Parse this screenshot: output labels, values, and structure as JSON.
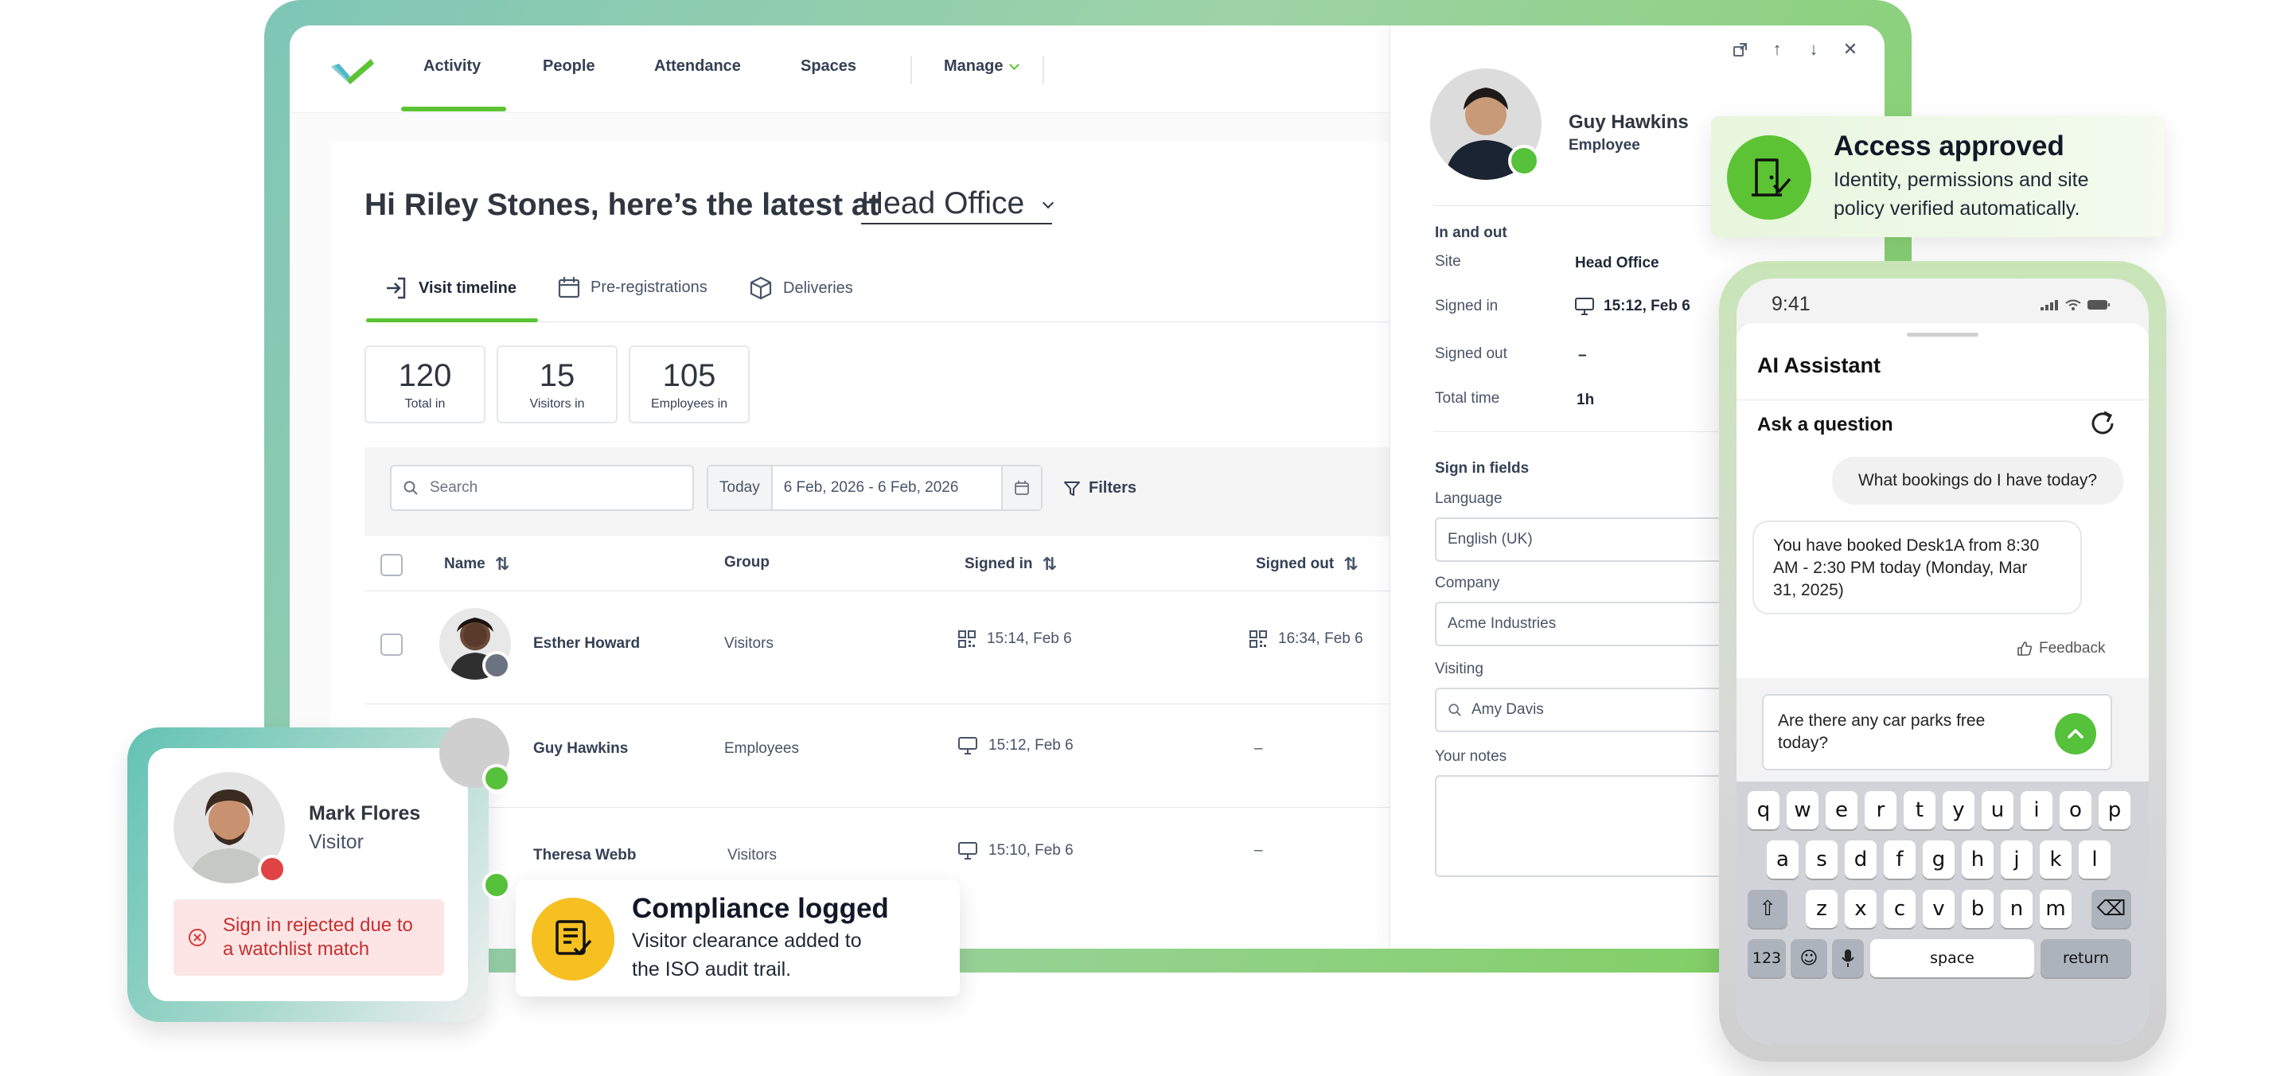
{
  "nav": {
    "items": [
      "Activity",
      "People",
      "Attendance",
      "Spaces",
      "Manage"
    ],
    "active": "Activity"
  },
  "header": {
    "greeting": "Hi Riley Stones, here’s the latest at",
    "site": "Head Office"
  },
  "tabs": [
    {
      "label": "Visit timeline",
      "icon": "sign-in-icon",
      "active": true
    },
    {
      "label": "Pre-registrations",
      "icon": "calendar-icon",
      "active": false
    },
    {
      "label": "Deliveries",
      "icon": "box-icon",
      "active": false
    }
  ],
  "stats": [
    {
      "value": "120",
      "label": "Total in"
    },
    {
      "value": "15",
      "label": "Visitors in"
    },
    {
      "value": "105",
      "label": "Employees in"
    }
  ],
  "filters": {
    "search_placeholder": "Search",
    "today_label": "Today",
    "date_range": "6 Feb, 2026 - 6 Feb, 2026",
    "filters_label": "Filters"
  },
  "table": {
    "headers": [
      "Name",
      "Group",
      "Signed in",
      "Signed out"
    ],
    "rows": [
      {
        "name": "Esther Howard",
        "group": "Visitors",
        "signed_in": "15:14, Feb 6",
        "signed_in_icon": "qr-code-icon",
        "signed_out": "16:34, Feb 6",
        "signed_out_icon": "qr-code-icon",
        "status": "grey"
      },
      {
        "name": "Guy Hawkins",
        "group": "Employees",
        "signed_in": "15:12, Feb 6",
        "signed_in_icon": "monitor-icon",
        "signed_out": "–",
        "status": "green"
      },
      {
        "name": "Theresa Webb",
        "group": "Visitors",
        "signed_in": "15:10, Feb 6",
        "signed_in_icon": "monitor-icon",
        "signed_out": "–",
        "status": "green"
      }
    ]
  },
  "panel": {
    "name": "Guy Hawkins",
    "role": "Employee",
    "in_out_title": "In and out",
    "site_label": "Site",
    "site_value": "Head Office",
    "signed_in_label": "Signed in",
    "signed_in_value": "15:12, Feb 6",
    "signed_out_label": "Signed out",
    "signed_out_value": "–",
    "total_time_label": "Total time",
    "total_time_value": "1h",
    "fields_title": "Sign in fields",
    "language_label": "Language",
    "language_value": "English (UK)",
    "company_label": "Company",
    "company_value": "Acme Industries",
    "visiting_label": "Visiting",
    "visiting_value": "Amy Davis",
    "notes_label": "Your notes"
  },
  "access_toast": {
    "title": "Access approved",
    "body_line1": "Identity, permissions and site",
    "body_line2": "policy verified automatically.",
    "icon": "door-check-icon"
  },
  "phone": {
    "time": "9:41",
    "title": "AI Assistant",
    "ask_label": "Ask a question",
    "user_msg": "What bookings do I have today?",
    "bot_msg_lines": [
      "You have booked Desk1A from 8:30",
      "AM - 2:30 PM today (Monday, Mar",
      "31, 2025)"
    ],
    "feedback_label": "Feedback",
    "input_lines": [
      "Are there any car parks free",
      "today?"
    ],
    "keyboard": {
      "row1": [
        "q",
        "w",
        "e",
        "r",
        "t",
        "y",
        "u",
        "i",
        "o",
        "p"
      ],
      "row2": [
        "a",
        "s",
        "d",
        "f",
        "g",
        "h",
        "j",
        "k",
        "l"
      ],
      "row3": [
        "z",
        "x",
        "c",
        "v",
        "b",
        "n",
        "m"
      ],
      "numbers_label": "123",
      "space_label": "space",
      "return_label": "return"
    }
  },
  "visitor_card": {
    "name": "Mark Flores",
    "role": "Visitor",
    "alert_line1": "Sign in rejected due to",
    "alert_line2": "a watchlist match"
  },
  "compliance_toast": {
    "title": "Compliance logged",
    "body_line1": "Visitor clearance added to",
    "body_line2": "the ISO audit trail.",
    "icon": "checklist-icon"
  },
  "colors": {
    "accent_green": "#5cc434",
    "status_green": "#56c13a",
    "status_grey": "#6b7280",
    "status_red": "#e04343",
    "compliance_yellow": "#f5c020"
  }
}
